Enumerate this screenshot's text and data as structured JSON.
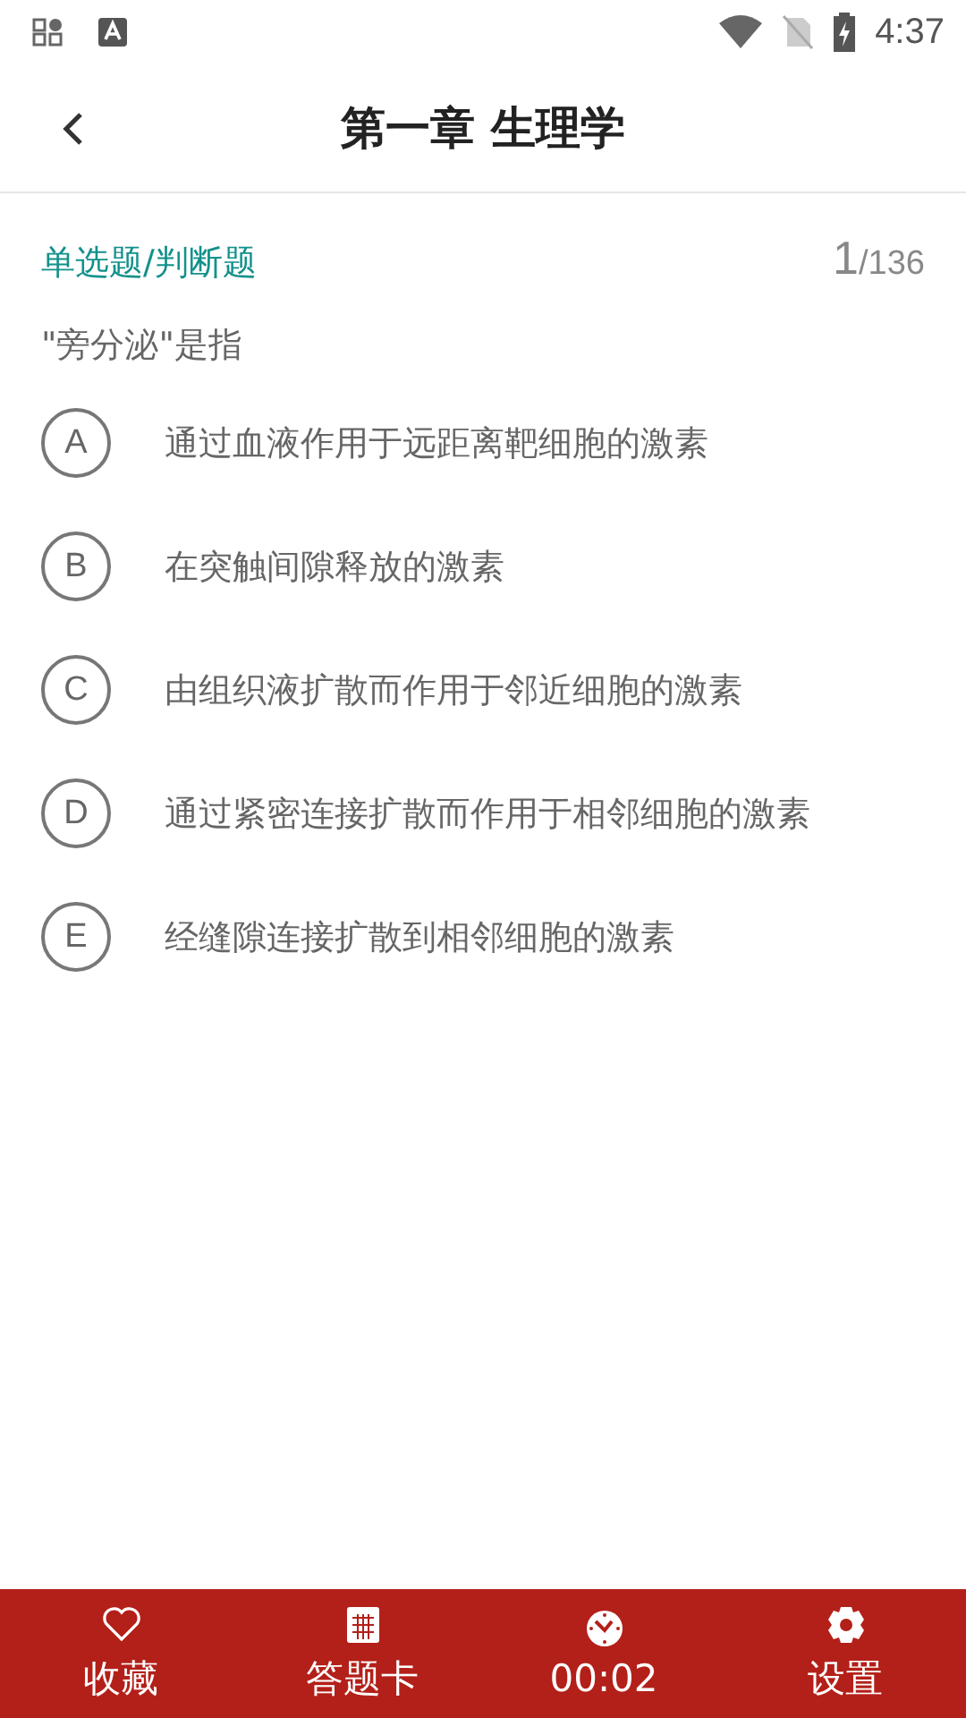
{
  "status_bar": {
    "time": "4:37"
  },
  "header": {
    "title": "第一章 生理学"
  },
  "question": {
    "type": "单选题/判断题",
    "current": "1",
    "total": "/136",
    "stem": "\"旁分泌\"是指",
    "options": [
      {
        "letter": "A",
        "text": "通过血液作用于远距离靶细胞的激素"
      },
      {
        "letter": "B",
        "text": "在突触间隙释放的激素"
      },
      {
        "letter": "C",
        "text": "由组织液扩散而作用于邻近细胞的激素"
      },
      {
        "letter": "D",
        "text": "通过紧密连接扩散而作用于相邻细胞的激素"
      },
      {
        "letter": "E",
        "text": "经缝隙连接扩散到相邻细胞的激素"
      }
    ]
  },
  "bottom_bar": [
    {
      "kind": "favorite",
      "label": "收藏"
    },
    {
      "kind": "card",
      "label": "答题卡"
    },
    {
      "kind": "timer",
      "label": "00:02"
    },
    {
      "kind": "settings",
      "label": "设置"
    }
  ]
}
